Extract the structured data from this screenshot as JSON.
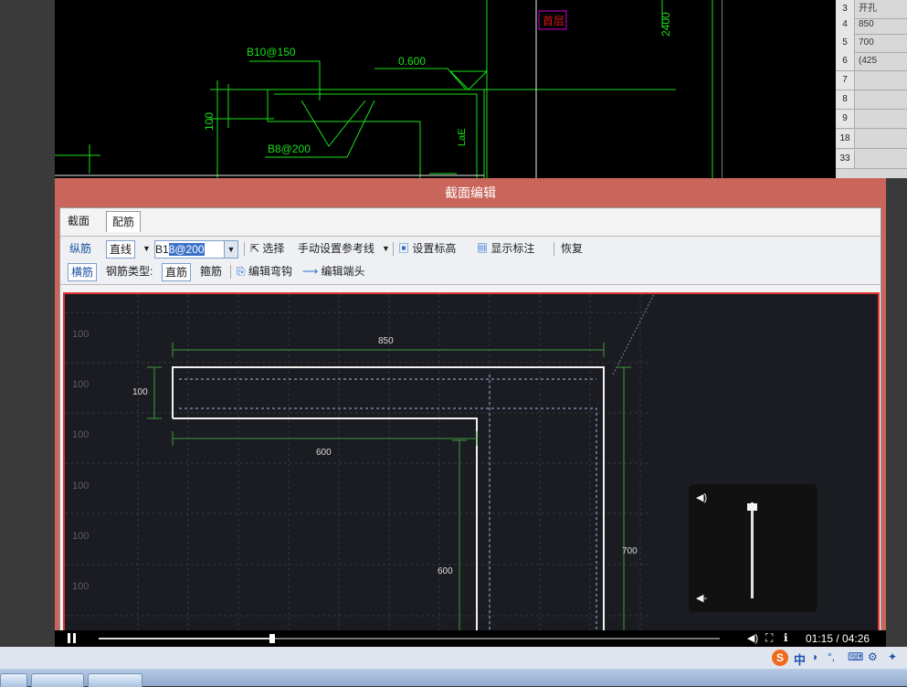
{
  "cad_view": {
    "floor_tag": "首层",
    "dim_2400": "2400",
    "rebar_top": "B10@150",
    "elevation": "0.600",
    "dim_100": "100",
    "rebar_bottom": "B8@200",
    "anchor_label": "LaE",
    "colors": {
      "line": "#19e019",
      "frame": "#e8e8e8",
      "tag_border": "#d000d0",
      "tag_text": "#e01a1a"
    }
  },
  "side_table": {
    "rows": [
      {
        "n": "3",
        "v": "开孔"
      },
      {
        "n": "4",
        "v": "850"
      },
      {
        "n": "5",
        "v": "700"
      },
      {
        "n": "6",
        "v": "(425"
      },
      {
        "n": "7",
        "v": ""
      },
      {
        "n": "8",
        "v": ""
      },
      {
        "n": "9",
        "v": ""
      },
      {
        "n": "18",
        "v": ""
      },
      {
        "n": "33",
        "v": ""
      }
    ]
  },
  "dialog": {
    "title": "截面编辑",
    "tabs": [
      "截面",
      "配筋"
    ],
    "active_tab": "配筋",
    "toolbar1": {
      "longitudinal": "纵筋",
      "line_mode": "直线",
      "rebar_prefix": "B1",
      "rebar_selected": "8@200",
      "select": "选择",
      "manual_ref": "手动设置参考线",
      "set_elevation": "设置标高",
      "show_annotation": "显示标注",
      "restore": "恢复"
    },
    "toolbar2": {
      "transverse": "横筋",
      "type_label": "钢筋类型:",
      "straight": "直筋",
      "stirrup": "箍筋",
      "edit_hook": "编辑弯钩",
      "edit_end": "编辑端头"
    },
    "canvas": {
      "grid_label": "100",
      "dim_850": "850",
      "dim_100": "100",
      "dim_600_h": "600",
      "dim_600_v": "600",
      "dim_700": "700"
    }
  },
  "player": {
    "time": "01:15 / 04:26",
    "progress": 0.28,
    "volume": 0.95
  },
  "ime": {
    "lang": "中"
  }
}
